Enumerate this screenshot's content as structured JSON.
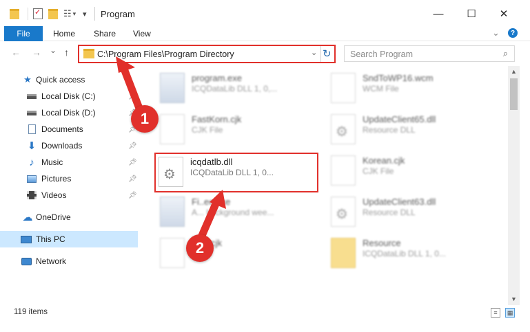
{
  "window": {
    "title": "Program",
    "controls": {
      "minimize": "—",
      "maximize": "☐",
      "close": "✕"
    }
  },
  "ribbon": {
    "tabs": [
      "File",
      "Home",
      "Share",
      "View"
    ],
    "help": "?"
  },
  "navigation": {
    "back": "←",
    "forward": "→",
    "recent": "⌄",
    "up": "↑"
  },
  "address_bar": {
    "path": "C:\\Program Files\\Program Directory"
  },
  "search": {
    "placeholder": "Search Program"
  },
  "sidebar": {
    "items": [
      {
        "label": "Quick access",
        "icon": "star-icon"
      },
      {
        "label": "Local Disk (C:)",
        "icon": "drive-icon",
        "pinned": true
      },
      {
        "label": "Local Disk (D:)",
        "icon": "drive-icon",
        "pinned": true
      },
      {
        "label": "Documents",
        "icon": "documents-icon",
        "pinned": true
      },
      {
        "label": "Downloads",
        "icon": "download-icon",
        "pinned": true
      },
      {
        "label": "Music",
        "icon": "music-icon",
        "pinned": true
      },
      {
        "label": "Pictures",
        "icon": "pictures-icon",
        "pinned": true
      },
      {
        "label": "Videos",
        "icon": "videos-icon",
        "pinned": true
      },
      {
        "label": "OneDrive",
        "icon": "cloud-icon"
      },
      {
        "label": "This PC",
        "icon": "computer-icon",
        "selected": true
      },
      {
        "label": "Network",
        "icon": "network-icon"
      }
    ]
  },
  "files": {
    "left": [
      {
        "name": "program.exe",
        "type": "ICQDataLib DLL 1, 0,..."
      },
      {
        "name": "FastKorn.cjk",
        "type": "CJK File"
      },
      {
        "name": "icqdatlb.dll",
        "type": "ICQDataLib DLL 1, 0..."
      },
      {
        "name": "Fi..ec.exe",
        "type": "A... background wee..."
      },
      {
        "name": "...mi.cjk",
        "type": "...e"
      }
    ],
    "right": [
      {
        "name": "SndToWP16.wcm",
        "type": "WCM File"
      },
      {
        "name": "UpdateClient65.dll",
        "type": "Resource DLL"
      },
      {
        "name": "Korean.cjk",
        "type": "CJK File"
      },
      {
        "name": "UpdateClient63.dll",
        "type": "Resource DLL"
      },
      {
        "name": "Resource",
        "type": "ICQDataLib DLL 1, 0..."
      }
    ]
  },
  "annotations": {
    "step1": "1",
    "step2": "2"
  },
  "status": {
    "count": "119 items"
  },
  "colors": {
    "accent": "#1979ca",
    "highlight": "#e1302b",
    "selection": "#cce8ff"
  }
}
